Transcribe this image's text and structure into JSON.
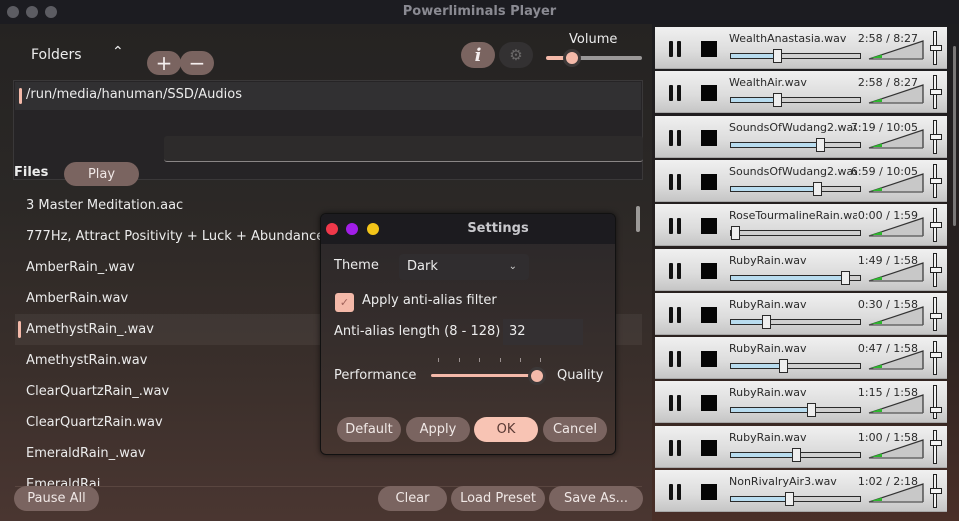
{
  "window": {
    "title": "Powerliminals Player",
    "controls": [
      "close",
      "minimize",
      "maximize"
    ]
  },
  "header": {
    "folders_label": "Folders",
    "collapse_icon": "chevron-up-icon",
    "add_folder_icon": "plus-icon",
    "remove_folder_icon": "minus-icon",
    "info_icon": "info-icon",
    "settings_icon": "gear-icon",
    "volume_label": "Volume",
    "volume_value_fraction": 0.3
  },
  "folders": [
    "/run/media/hanuman/SSD/Audios"
  ],
  "files_section": {
    "label": "Files",
    "play_label": "Play",
    "search_value": ""
  },
  "files": [
    "3 Master Meditation.aac",
    "777Hz, Attract Positivity + Luck + Abundance.",
    "AmberRain_.wav",
    "AmberRain.wav",
    "AmethystRain_.wav",
    "AmethystRain.wav",
    "ClearQuartzRain_.wav",
    "ClearQuartzRain.wav",
    "EmeraldRain_.wav",
    "EmeraldRai..."
  ],
  "selected_file_index": 4,
  "footer": {
    "pause_all_label": "Pause All",
    "clear_label": "Clear",
    "load_preset_label": "Load Preset",
    "save_as_label": "Save As..."
  },
  "settings_dialog": {
    "title": "Settings",
    "theme_label": "Theme",
    "theme_value": "Dark",
    "antialias_checkbox_label": "Apply anti-alias filter",
    "antialias_checked": true,
    "antialias_length_label": "Anti-alias length (8 - 128)",
    "antialias_length_value": "32",
    "performance_label": "Performance",
    "quality_label": "Quality",
    "quality_slider_position": 1.0,
    "buttons": {
      "default": "Default",
      "apply": "Apply",
      "ok": "OK",
      "cancel": "Cancel"
    }
  },
  "tracks": [
    {
      "name": "WealthAnastasia.wav",
      "time": "2:58 / 8:27",
      "progress": 0.35,
      "volume": 0.5
    },
    {
      "name": "WealthAir.wav",
      "time": "2:58 / 8:27",
      "progress": 0.35,
      "volume": 0.5
    },
    {
      "name": "SoundsOfWudang2.wav",
      "time": "7:19 / 10:05",
      "progress": 0.71,
      "volume": 0.5
    },
    {
      "name": "SoundsOfWudang2.wav",
      "time": "6:59 / 10:05",
      "progress": 0.68,
      "volume": 0.5
    },
    {
      "name": "RoseTourmalineRain.wav",
      "time": "0:00 / 1:59",
      "progress": 0.0,
      "volume": 0.5
    },
    {
      "name": "RubyRain.wav",
      "time": "1:49 / 1:58",
      "progress": 0.92,
      "volume": 0.5
    },
    {
      "name": "RubyRain.wav",
      "time": "0:30 / 1:58",
      "progress": 0.26,
      "volume": 0.4
    },
    {
      "name": "RubyRain.wav",
      "time": "0:47 / 1:58",
      "progress": 0.4,
      "volume": 0.6
    },
    {
      "name": "RubyRain.wav",
      "time": "1:15 / 1:58",
      "progress": 0.63,
      "volume": 0.2
    },
    {
      "name": "RubyRain.wav",
      "time": "1:00 / 1:58",
      "progress": 0.51,
      "volume": 0.65
    },
    {
      "name": "NonRivalryAir3.wav",
      "time": "1:02 / 2:18",
      "progress": 0.45,
      "volume": 0.5
    }
  ],
  "colors": {
    "accent": "#f4b9a9",
    "button": "#7a6460",
    "meter_green": "#2eb82e",
    "progress_fill": "#b8dcef"
  }
}
